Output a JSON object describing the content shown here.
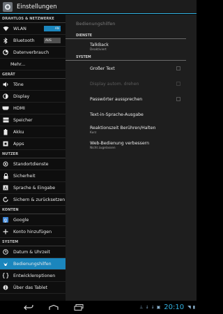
{
  "actionbar": {
    "title": "Einstellungen"
  },
  "left": {
    "sections": [
      {
        "label": "DRAHTLOS & NETZWERKE",
        "items": [
          {
            "label": "WLAN",
            "icon": "wifi-icon",
            "toggle": "AN"
          },
          {
            "label": "Bluetooth",
            "icon": "bluetooth-icon",
            "toggle": "AUS"
          },
          {
            "label": "Datenverbrauch",
            "icon": "data-usage-icon"
          },
          {
            "label": "Mehr..."
          }
        ]
      },
      {
        "label": "GERÄT",
        "items": [
          {
            "label": "Töne",
            "icon": "volume-icon"
          },
          {
            "label": "Display",
            "icon": "display-icon"
          },
          {
            "label": "HDMI",
            "icon": "hdmi-icon"
          },
          {
            "label": "Speicher",
            "icon": "storage-icon"
          },
          {
            "label": "Akku",
            "icon": "battery-icon"
          },
          {
            "label": "Apps",
            "icon": "apps-icon"
          }
        ]
      },
      {
        "label": "NUTZER",
        "items": [
          {
            "label": "Standortdienste",
            "icon": "location-icon"
          },
          {
            "label": "Sicherheit",
            "icon": "lock-icon"
          },
          {
            "label": "Sprache & Eingabe",
            "icon": "language-icon"
          },
          {
            "label": "Sichern & zurücksetzen",
            "icon": "backup-icon"
          }
        ]
      },
      {
        "label": "KONTEN",
        "items": [
          {
            "label": "Google",
            "icon": "google-icon"
          },
          {
            "label": "Konto hinzufügen",
            "icon": "plus-icon"
          }
        ]
      },
      {
        "label": "SYSTEM",
        "items": [
          {
            "label": "Datum & Uhrzeit",
            "icon": "clock-icon"
          },
          {
            "label": "Bedienungshilfen",
            "icon": "accessibility-icon",
            "selected": true
          },
          {
            "label": "Entwickleroptionen",
            "icon": "developer-icon"
          },
          {
            "label": "Über das Tablet",
            "icon": "info-icon"
          }
        ]
      }
    ]
  },
  "right": {
    "title": "Bedienungshilfen",
    "services_header": "DIENSTE",
    "talkback_title": "TalkBack",
    "talkback_sub": "Deaktiviert",
    "system_header": "SYSTEM",
    "large_text": "Großer Text",
    "auto_rotate": "Display autom. drehen",
    "speak_passwords": "Passwörter aussprechen",
    "tts_output": "Text-in-Sprache-Ausgabe",
    "touch_hold_title": "Reaktionszeit Berühren/Halten",
    "touch_hold_sub": "Kurz",
    "web_access_title": "Web-Bedienung verbessern",
    "web_access_sub": "Nicht zugelassen"
  },
  "status": {
    "time": "20:10"
  },
  "colors": {
    "accent": "#33b5e5",
    "selected": "#1b86bd"
  }
}
